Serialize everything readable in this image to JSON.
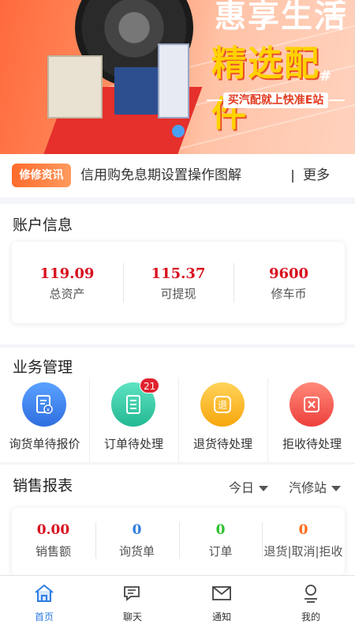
{
  "banner": {
    "top_text": "惠享生活",
    "main_text": "精选配件",
    "hash": "#",
    "slogan": "买汽配就上快准E站"
  },
  "news": {
    "tag": "修修资讯",
    "title": "信用购免息期设置操作图解",
    "more": "更多"
  },
  "account": {
    "title": "账户信息",
    "items": [
      {
        "value": "119.09",
        "label": "总资产"
      },
      {
        "value": "115.37",
        "label": "可提现"
      },
      {
        "value": "9600",
        "label": "修车币"
      }
    ]
  },
  "business": {
    "title": "业务管理",
    "items": [
      {
        "label": "询货单待报价",
        "icon": "inquiry-doc-icon",
        "color": "#3a86f0"
      },
      {
        "label": "订单待处理",
        "icon": "order-list-icon",
        "color": "#33c9a6",
        "badge": "21"
      },
      {
        "label": "退货待处理",
        "icon": "return-icon",
        "color": "#f9b320",
        "glyph": "退"
      },
      {
        "label": "拒收待处理",
        "icon": "reject-icon",
        "color": "#f4524d"
      }
    ]
  },
  "sales": {
    "title": "销售报表",
    "filter_period": "今日",
    "filter_scope": "汽修站",
    "items": [
      {
        "value": "0.00",
        "label": "销售额",
        "color": "#d9101f"
      },
      {
        "value": "0",
        "label": "询货单",
        "color": "#2f7de1"
      },
      {
        "value": "0",
        "label": "订单",
        "color": "#2cbf2c"
      },
      {
        "value": "0",
        "label": "退货|取消|拒收",
        "color": "#ff6a1a"
      }
    ]
  },
  "tabbar": {
    "items": [
      {
        "label": "首页",
        "icon": "home-icon",
        "active": true
      },
      {
        "label": "聊天",
        "icon": "chat-icon"
      },
      {
        "label": "通知",
        "icon": "mail-icon"
      },
      {
        "label": "我的",
        "icon": "profile-icon"
      }
    ]
  },
  "colors": {
    "accent": "#2f7de1",
    "price_red": "#d9101f"
  }
}
